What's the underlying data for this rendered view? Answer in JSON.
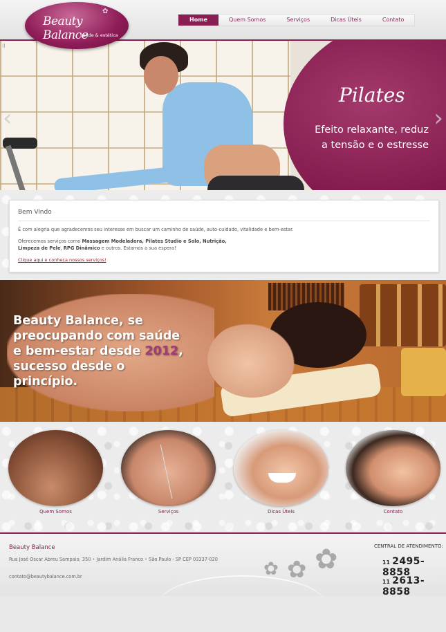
{
  "logo": {
    "brand": "Beauty Balance",
    "tagline": "saúde & estética"
  },
  "nav": [
    {
      "label": "Home"
    },
    {
      "label": "Quem Somos"
    },
    {
      "label": "Serviços"
    },
    {
      "label": "Dicas Úteis"
    },
    {
      "label": "Contato"
    }
  ],
  "slider": {
    "title": "Pilates",
    "text": "Efeito relaxante, reduz a tensão e o estresse",
    "prev_arrow": "‹",
    "next_arrow": "›",
    "pause_icon": "II"
  },
  "welcome": {
    "heading": "Bem Vindo",
    "intro": "É com alegria que agradecemos seu interesse em buscar um caminho de saúde, auto-cuidado, vitalidade e bem-estar.",
    "services_prefix": "Oferecemos serviços como",
    "services_bold_1": "Massagem Modeladora, Pilates Studio e Solo, Nutrição,",
    "services_bold_2": "Limpeza de Pele",
    "services_sep": ",",
    "services_bold_3": "RPG Dinâmico",
    "services_suffix": "e outros.  Estamos a sua espera!",
    "link": "Clique aqui e conheça nossos serviços!"
  },
  "banner": {
    "line_1": "Beauty Balance, se",
    "line_2": "preocupando com saúde",
    "line_3": "e bem-estar desde",
    "year": "2012",
    "line_3_end": ",",
    "line_4": "sucesso desde o",
    "line_5": "princípio."
  },
  "circles": [
    {
      "label": "Quem Somos"
    },
    {
      "label": "Serviços"
    },
    {
      "label": "Dicas Úteis"
    },
    {
      "label": "Contato"
    }
  ],
  "footer": {
    "brand": "Beauty Balance",
    "address_1": "Rua José Oscar Abreu Sampaio, 350",
    "address_2": "Jardim Anália Franco",
    "address_3": "São Paulo - SP CEP 03337-020",
    "separator": "•",
    "email": "contato@beautybalance.com.br",
    "central_label": "CENTRAL DE ATENDIMENTO:",
    "phones": [
      {
        "area": "11",
        "number": "2495-8858"
      },
      {
        "area": "11",
        "number": "2613-8858"
      }
    ],
    "flower_icon": "✿"
  },
  "colors": {
    "brand": "#8a1d52",
    "accent_year": "#a33a78"
  }
}
